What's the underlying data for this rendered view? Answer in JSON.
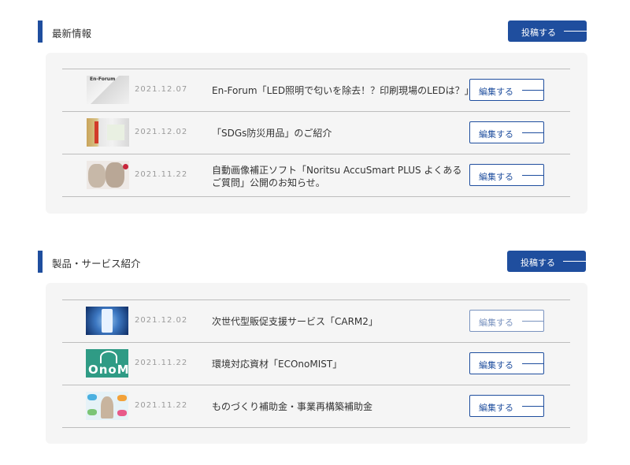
{
  "latest": {
    "title": "最新情報",
    "post_label": "投稿する",
    "items": [
      {
        "date": "2021.12.07",
        "title": "En-Forum「LED照明で匂いを除去！？印刷現場のLEDは？」",
        "edit_label": "編集する",
        "thumb_text": "En-Forum"
      },
      {
        "date": "2021.12.02",
        "title": "「SDGs防災用品」のご紹介",
        "edit_label": "編集する"
      },
      {
        "date": "2021.11.22",
        "title": "自動画像補正ソフト「Noritsu AccuSmart PLUS よくあるご質問」公開のお知らせ。",
        "edit_label": "編集する"
      }
    ]
  },
  "products": {
    "title": "製品・サービス紹介",
    "post_label": "投稿する",
    "items": [
      {
        "date": "2021.12.02",
        "title": "次世代型販促支援サービス「CARM2」",
        "edit_label": "編集する"
      },
      {
        "date": "2021.11.22",
        "title": "環境対応資材「ECOnoMIST」",
        "edit_label": "編集する",
        "thumb_text": "OnoM"
      },
      {
        "date": "2021.11.22",
        "title": "ものづくり補助金・事業再構築補助金",
        "edit_label": "編集する"
      }
    ]
  },
  "colors": {
    "accent": "#1f4e9e",
    "panel": "#f5f5f5",
    "divider": "#bdbdbd",
    "date": "#9a9a9a"
  }
}
